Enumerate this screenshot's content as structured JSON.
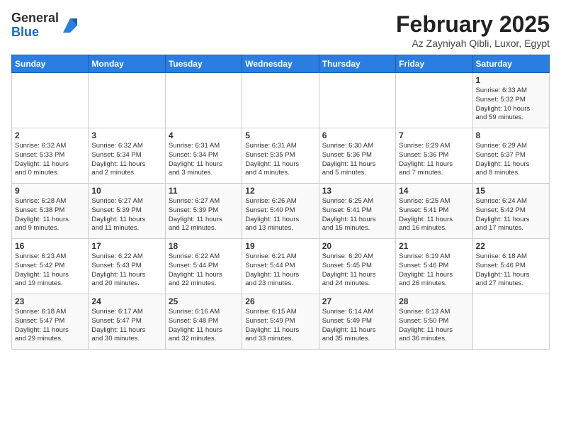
{
  "logo": {
    "line1": "General",
    "line2": "Blue"
  },
  "title": "February 2025",
  "subtitle": "Az Zayniyah Qibli, Luxor, Egypt",
  "days_of_week": [
    "Sunday",
    "Monday",
    "Tuesday",
    "Wednesday",
    "Thursday",
    "Friday",
    "Saturday"
  ],
  "weeks": [
    [
      {
        "day": "",
        "info": ""
      },
      {
        "day": "",
        "info": ""
      },
      {
        "day": "",
        "info": ""
      },
      {
        "day": "",
        "info": ""
      },
      {
        "day": "",
        "info": ""
      },
      {
        "day": "",
        "info": ""
      },
      {
        "day": "1",
        "info": "Sunrise: 6:33 AM\nSunset: 5:32 PM\nDaylight: 10 hours\nand 59 minutes."
      }
    ],
    [
      {
        "day": "2",
        "info": "Sunrise: 6:32 AM\nSunset: 5:33 PM\nDaylight: 11 hours\nand 0 minutes."
      },
      {
        "day": "3",
        "info": "Sunrise: 6:32 AM\nSunset: 5:34 PM\nDaylight: 11 hours\nand 2 minutes."
      },
      {
        "day": "4",
        "info": "Sunrise: 6:31 AM\nSunset: 5:34 PM\nDaylight: 11 hours\nand 3 minutes."
      },
      {
        "day": "5",
        "info": "Sunrise: 6:31 AM\nSunset: 5:35 PM\nDaylight: 11 hours\nand 4 minutes."
      },
      {
        "day": "6",
        "info": "Sunrise: 6:30 AM\nSunset: 5:36 PM\nDaylight: 11 hours\nand 5 minutes."
      },
      {
        "day": "7",
        "info": "Sunrise: 6:29 AM\nSunset: 5:36 PM\nDaylight: 11 hours\nand 7 minutes."
      },
      {
        "day": "8",
        "info": "Sunrise: 6:29 AM\nSunset: 5:37 PM\nDaylight: 11 hours\nand 8 minutes."
      }
    ],
    [
      {
        "day": "9",
        "info": "Sunrise: 6:28 AM\nSunset: 5:38 PM\nDaylight: 11 hours\nand 9 minutes."
      },
      {
        "day": "10",
        "info": "Sunrise: 6:27 AM\nSunset: 5:39 PM\nDaylight: 11 hours\nand 11 minutes."
      },
      {
        "day": "11",
        "info": "Sunrise: 6:27 AM\nSunset: 5:39 PM\nDaylight: 11 hours\nand 12 minutes."
      },
      {
        "day": "12",
        "info": "Sunrise: 6:26 AM\nSunset: 5:40 PM\nDaylight: 11 hours\nand 13 minutes."
      },
      {
        "day": "13",
        "info": "Sunrise: 6:25 AM\nSunset: 5:41 PM\nDaylight: 11 hours\nand 15 minutes."
      },
      {
        "day": "14",
        "info": "Sunrise: 6:25 AM\nSunset: 5:41 PM\nDaylight: 11 hours\nand 16 minutes."
      },
      {
        "day": "15",
        "info": "Sunrise: 6:24 AM\nSunset: 5:42 PM\nDaylight: 11 hours\nand 17 minutes."
      }
    ],
    [
      {
        "day": "16",
        "info": "Sunrise: 6:23 AM\nSunset: 5:42 PM\nDaylight: 11 hours\nand 19 minutes."
      },
      {
        "day": "17",
        "info": "Sunrise: 6:22 AM\nSunset: 5:43 PM\nDaylight: 11 hours\nand 20 minutes."
      },
      {
        "day": "18",
        "info": "Sunrise: 6:22 AM\nSunset: 5:44 PM\nDaylight: 11 hours\nand 22 minutes."
      },
      {
        "day": "19",
        "info": "Sunrise: 6:21 AM\nSunset: 5:44 PM\nDaylight: 11 hours\nand 23 minutes."
      },
      {
        "day": "20",
        "info": "Sunrise: 6:20 AM\nSunset: 5:45 PM\nDaylight: 11 hours\nand 24 minutes."
      },
      {
        "day": "21",
        "info": "Sunrise: 6:19 AM\nSunset: 5:46 PM\nDaylight: 11 hours\nand 26 minutes."
      },
      {
        "day": "22",
        "info": "Sunrise: 6:18 AM\nSunset: 5:46 PM\nDaylight: 11 hours\nand 27 minutes."
      }
    ],
    [
      {
        "day": "23",
        "info": "Sunrise: 6:18 AM\nSunset: 5:47 PM\nDaylight: 11 hours\nand 29 minutes."
      },
      {
        "day": "24",
        "info": "Sunrise: 6:17 AM\nSunset: 5:47 PM\nDaylight: 11 hours\nand 30 minutes."
      },
      {
        "day": "25",
        "info": "Sunrise: 6:16 AM\nSunset: 5:48 PM\nDaylight: 11 hours\nand 32 minutes."
      },
      {
        "day": "26",
        "info": "Sunrise: 6:15 AM\nSunset: 5:49 PM\nDaylight: 11 hours\nand 33 minutes."
      },
      {
        "day": "27",
        "info": "Sunrise: 6:14 AM\nSunset: 5:49 PM\nDaylight: 11 hours\nand 35 minutes."
      },
      {
        "day": "28",
        "info": "Sunrise: 6:13 AM\nSunset: 5:50 PM\nDaylight: 11 hours\nand 36 minutes."
      },
      {
        "day": "",
        "info": ""
      }
    ]
  ]
}
